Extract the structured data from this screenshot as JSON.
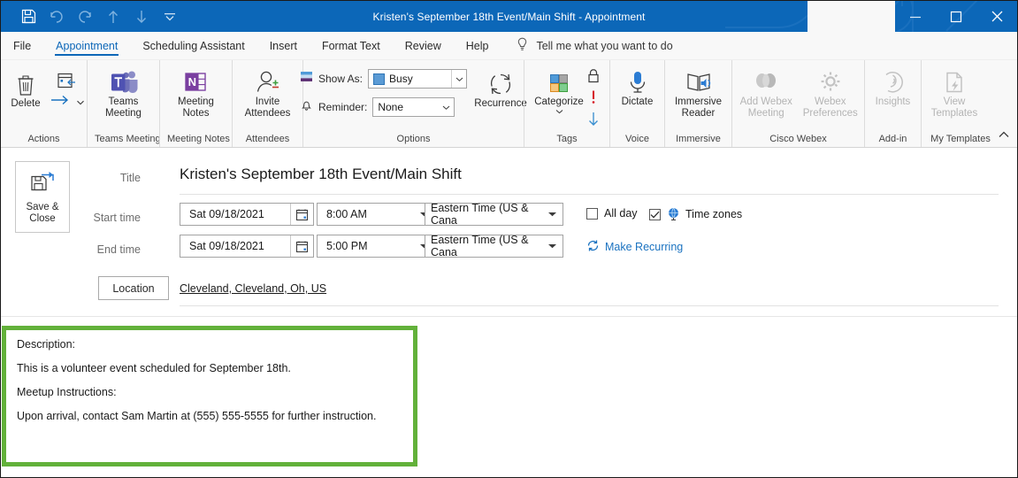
{
  "window": {
    "title": "Kristen's September 18th Event/Main Shift  -  Appointment",
    "quick_access": [
      {
        "name": "save-icon",
        "label": "Save"
      },
      {
        "name": "undo-icon",
        "label": "Undo"
      },
      {
        "name": "redo-icon",
        "label": "Redo"
      },
      {
        "name": "previous-item-icon",
        "label": "Previous Item"
      },
      {
        "name": "next-item-icon",
        "label": "Next Item"
      },
      {
        "name": "customize-quick-access-toolbar-icon",
        "label": "Customize Quick Access Toolbar"
      }
    ],
    "controls": [
      {
        "name": "ribbon-display-options",
        "label": "Ribbon Display Options"
      },
      {
        "name": "minimize",
        "label": "Minimize"
      },
      {
        "name": "maximize",
        "label": "Maximize"
      },
      {
        "name": "close",
        "label": "Close"
      }
    ],
    "accent_color": "#0c67b8"
  },
  "tabs": [
    {
      "label": "File",
      "active": false
    },
    {
      "label": "Appointment",
      "active": true
    },
    {
      "label": "Scheduling Assistant",
      "active": false
    },
    {
      "label": "Insert",
      "active": false
    },
    {
      "label": "Format Text",
      "active": false
    },
    {
      "label": "Review",
      "active": false
    },
    {
      "label": "Help",
      "active": false
    }
  ],
  "tell_me": {
    "icon": "lightbulb-icon",
    "placeholder": "Tell me what you want to do"
  },
  "ribbon": {
    "groups": [
      {
        "name": "Actions",
        "buttons": [
          {
            "label": "Delete",
            "icon": "trash-icon",
            "disabled": false
          }
        ]
      },
      {
        "name": "Teams Meeting",
        "buttons": [
          {
            "label": "Teams\nMeeting",
            "label_l1": "Teams",
            "label_l2": "Meeting",
            "icon": "teams-icon",
            "disabled": false
          }
        ]
      },
      {
        "name": "Meeting Notes",
        "buttons": [
          {
            "label_l1": "Meeting",
            "label_l2": "Notes",
            "icon": "onenote-icon",
            "disabled": false
          }
        ]
      },
      {
        "name": "Attendees",
        "buttons": [
          {
            "label_l1": "Invite",
            "label_l2": "Attendees",
            "icon": "invite-attendees-icon",
            "disabled": false
          }
        ]
      },
      {
        "name": "Options",
        "buttons": []
      },
      {
        "name": "Tags",
        "buttons": [
          {
            "label_l1": "Categorize",
            "label_l2": "",
            "icon": "categorize-icon",
            "disabled": false
          }
        ]
      },
      {
        "name": "Voice",
        "buttons": [
          {
            "label_l1": "Dictate",
            "label_l2": "",
            "icon": "microphone-icon",
            "disabled": false
          }
        ]
      },
      {
        "name": "Immersive",
        "buttons": [
          {
            "label_l1": "Immersive",
            "label_l2": "Reader",
            "icon": "immersive-reader-icon",
            "disabled": false
          }
        ]
      },
      {
        "name": "Cisco Webex",
        "buttons": [
          {
            "label_l1": "Add Webex",
            "label_l2": "Meeting",
            "icon": "webex-icon",
            "disabled": true
          },
          {
            "label_l1": "Webex",
            "label_l2": "Preferences",
            "icon": "gear-icon",
            "disabled": true
          }
        ]
      },
      {
        "name": "Add-in",
        "buttons": [
          {
            "label_l1": "Insights",
            "label_l2": "",
            "icon": "insights-icon",
            "disabled": true
          }
        ]
      },
      {
        "name": "My Templates",
        "buttons": [
          {
            "label_l1": "View",
            "label_l2": "Templates",
            "icon": "view-templates-icon",
            "disabled": true
          }
        ]
      }
    ],
    "labels": {
      "actions": "Actions",
      "teams_meeting_group": "Teams Meeting",
      "meeting_notes_group": "Meeting Notes",
      "attendees_group": "Attendees",
      "options_group": "Options",
      "tags_group": "Tags",
      "voice_group": "Voice",
      "immersive_group": "Immersive",
      "webex_group": "Cisco Webex",
      "addin_group": "Add-in",
      "templates_group": "My Templates",
      "delete": "Delete",
      "teams_l1": "Teams",
      "teams_l2": "Meeting",
      "notes_l1": "Meeting",
      "notes_l2": "Notes",
      "invite_l1": "Invite",
      "invite_l2": "Attendees",
      "categorize": "Categorize",
      "recurrence": "Recurrence",
      "dictate": "Dictate",
      "immersive_l1": "Immersive",
      "immersive_l2": "Reader",
      "webex_l1": "Add Webex",
      "webex_l2": "Meeting",
      "prefs_l1": "Webex",
      "prefs_l2": "Preferences",
      "insights": "Insights",
      "templates_l1": "View",
      "templates_l2": "Templates",
      "collapse_ribbon": "Collapse the Ribbon"
    },
    "options": {
      "show_as_label": "Show As:",
      "show_as_value": "Busy",
      "show_as_color": "#5b9bd5",
      "reminder_label": "Reminder:",
      "reminder_value": "None"
    }
  },
  "form": {
    "save_close_l1": "Save &",
    "save_close_l2": "Close",
    "labels": {
      "title": "Title",
      "start_time": "Start time",
      "end_time": "End time",
      "location": "Location"
    },
    "title_value": "Kristen's September 18th Event/Main Shift",
    "start_date": "Sat 09/18/2021",
    "start_time": "8:00 AM",
    "start_timezone": "Eastern Time (US & Cana",
    "end_date": "Sat 09/18/2021",
    "end_time": "5:00 PM",
    "end_timezone": "Eastern Time (US & Cana",
    "all_day_label": "All day",
    "all_day_checked": false,
    "time_zones_label": "Time zones",
    "time_zones_checked": true,
    "make_recurring_label": "Make Recurring",
    "location_value": "Cleveland, Cleveland, Oh, US"
  },
  "description": {
    "highlight_color": "#62b13a",
    "lines": [
      "Description:",
      "This is a volunteer event scheduled for September 18th.",
      "Meetup Instructions:",
      "Upon arrival, contact Sam Martin at (555) 555-5555 for further instruction."
    ]
  }
}
